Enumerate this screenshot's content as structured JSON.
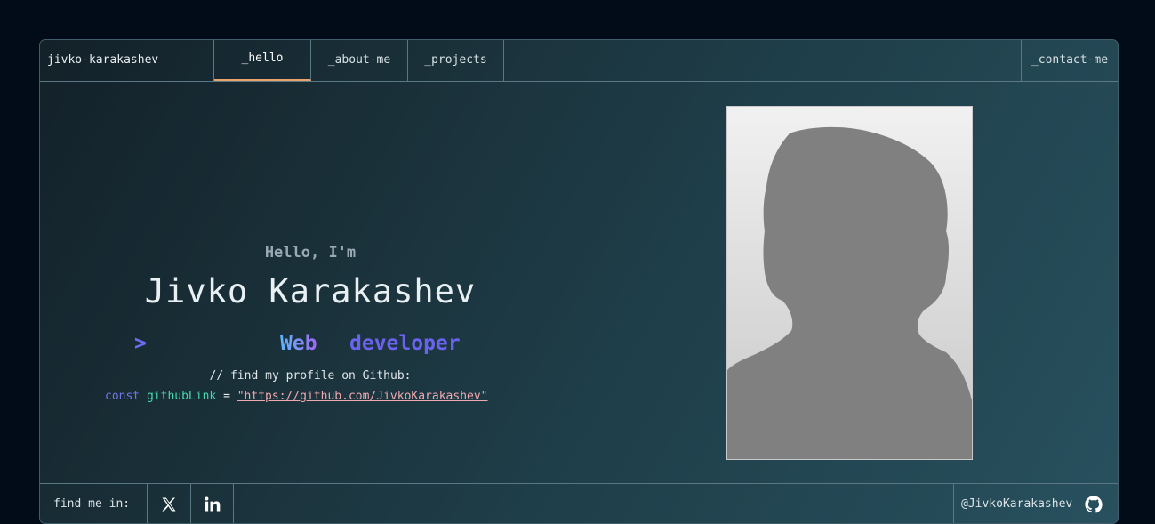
{
  "nav": {
    "brand": "jivko-karakashev",
    "tabs": [
      {
        "label": "_hello",
        "active": true
      },
      {
        "label": "_about-me",
        "active": false
      },
      {
        "label": "_projects",
        "active": false
      }
    ],
    "contact": "_contact-me"
  },
  "hero": {
    "greeting": "Hello, I'm",
    "name": "Jivko Karakashev",
    "prompt": ">",
    "role_word1": "Web",
    "role_word2": "developer",
    "comment": "// find my profile on Github:",
    "code_keyword": "const",
    "code_var": "githubLink",
    "code_op": "=",
    "code_link": "\"https://github.com/JivkoKarakashev\""
  },
  "photo": {
    "icon": "profile-silhouette"
  },
  "footer": {
    "find_label": "find me in:",
    "socials": [
      {
        "icon": "x-twitter-icon"
      },
      {
        "icon": "linkedin-icon"
      }
    ],
    "github_handle": "@JivkoKarakashev",
    "github_icon": "github-icon"
  },
  "colors": {
    "page_bg": "#010c18",
    "accent_tab": "#e8a46a",
    "keyword": "#6e78ea",
    "variable": "#43d9ad",
    "link": "#f0a8b0",
    "role": "#6b62f0"
  }
}
